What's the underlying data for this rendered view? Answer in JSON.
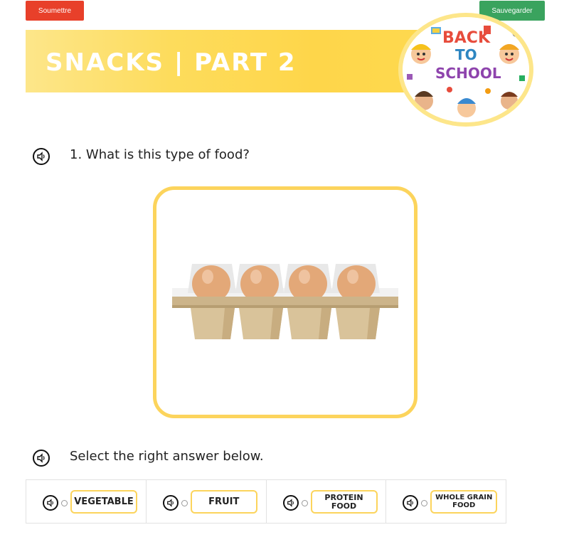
{
  "toolbar": {
    "submit_label": "Soumettre",
    "save_label": "Sauvegarder"
  },
  "header": {
    "title": "SNACKS | PART 2",
    "badge_text": [
      "BACK",
      "TO",
      "SCHOOL"
    ]
  },
  "questions": [
    {
      "text": "1. What is this type of food?"
    },
    {
      "text": "Select the right answer below."
    }
  ],
  "answers": [
    {
      "label": "VEGETABLE"
    },
    {
      "label": "FRUIT"
    },
    {
      "label": "PROTEIN FOOD"
    },
    {
      "label": "WHOLE GRAIN FOOD"
    }
  ],
  "colors": {
    "submit": "#e8402a",
    "save": "#3aa35e",
    "accent_yellow": "#fcd45c",
    "banner_yellow": "#fed64a"
  },
  "icons": {
    "audio": "speaker-icon",
    "image": "egg-carton"
  }
}
